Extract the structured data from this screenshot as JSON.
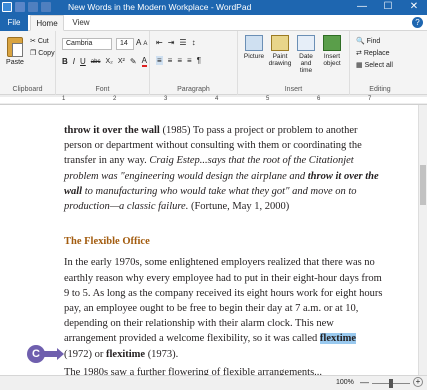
{
  "window": {
    "title": "New Words in the Modern Workplace - WordPad",
    "minimize": "—",
    "maximize": "☐",
    "close": "✕"
  },
  "tabs": {
    "file": "File",
    "home": "Home",
    "view": "View",
    "help": "?"
  },
  "clipboard": {
    "paste": "Paste",
    "cut": "Cut",
    "copy": "Copy",
    "label": "Clipboard"
  },
  "font": {
    "name": "Cambria",
    "size": "14",
    "grow": "A",
    "shrink": "A",
    "bold": "B",
    "italic": "I",
    "underline": "U",
    "strike": "abc",
    "subscript": "X₂",
    "superscript": "X²",
    "highlight": "✎",
    "color": "A",
    "label": "Font"
  },
  "paragraph": {
    "indent_dec": "⇤",
    "indent_inc": "⇥",
    "list": "☰",
    "spacing": "↕",
    "align_left": "≡",
    "align_center": "≡",
    "align_right": "≡",
    "justify": "≡",
    "para_btn": "¶",
    "label": "Paragraph"
  },
  "insert": {
    "picture": "Picture",
    "paint": "Paint drawing",
    "datetime": "Date and time",
    "object": "Insert object",
    "label": "Insert"
  },
  "editing": {
    "find": "Find",
    "replace": "Replace",
    "select_all": "Select all",
    "label": "Editing"
  },
  "ruler": {
    "marks": [
      "1",
      "2",
      "3",
      "4",
      "5",
      "6",
      "7"
    ]
  },
  "document": {
    "p1_term": "throw it over the wall",
    "p1_rest": " (1985) To pass a project or problem to another person or department without consulting with them or coordinating the transfer in any way. ",
    "p1_quote_a": "Craig Estep...says that the root of the Citationjet problem was \"engineering would design the airplane and ",
    "p1_quote_term": "throw it over the wall",
    "p1_quote_b": " to manufacturing who would take what they got\" and move on to production—a classic failure.",
    "p1_cite": " (Fortune, May 1, 2000)",
    "heading": "The Flexible Office",
    "p2_text": "In the early 1970s, some enlightened employers realized that there was no earthly reason why every employee had to put in their eight-hour days from 9 to 5. As long as the company received its eight hours work for eight hours pay, an employee ought to be free to begin their day at 7 a.m. or at 10, depending on their relationship with their alarm clock. This new arrangement provided a welcome flexibility, so it was called ",
    "p2_sel": "flextime",
    "p2_mid": " (1972) or ",
    "p2_term2": "flexitime",
    "p2_end": " (1973).",
    "cut_line": "The 1980s saw a further flowering of flexible arrangements..."
  },
  "callout": "C",
  "status": {
    "zoom": "100%",
    "minus": "—",
    "plus": "+"
  }
}
